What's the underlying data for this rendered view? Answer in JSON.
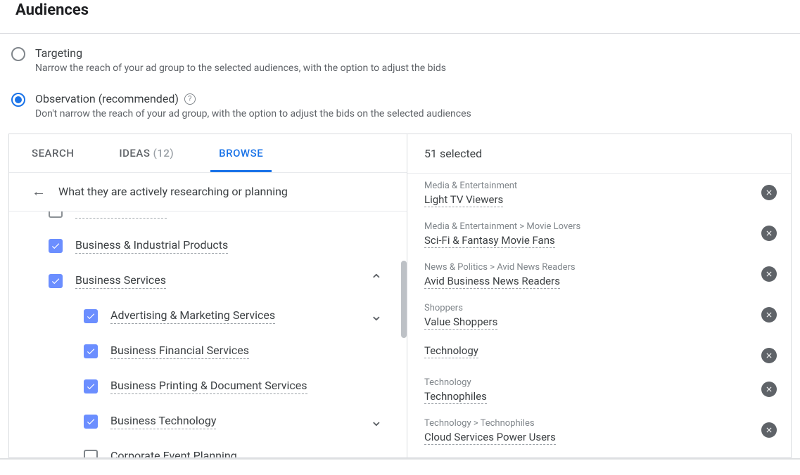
{
  "title": "Audiences",
  "targetingOptions": {
    "targeting": {
      "label": "Targeting",
      "desc": "Narrow the reach of your ad group to the selected audiences, with the option to adjust the bids",
      "selected": false
    },
    "observation": {
      "label": "Observation (recommended)",
      "desc": "Don't narrow the reach of your ad group, with the option to adjust the bids on the selected audiences",
      "selected": true
    }
  },
  "tabs": {
    "search": "SEARCH",
    "ideas_label": "IDEAS",
    "ideas_count": "(12)",
    "browse": "BROWSE"
  },
  "browse": {
    "crumb": "What they are actively researching or planning",
    "items": [
      {
        "label": "",
        "checked": false,
        "cut": true
      },
      {
        "label": "Business & Industrial Products",
        "checked": true
      },
      {
        "label": "Business Services",
        "checked": true,
        "expanded": true,
        "children": [
          {
            "label": "Advertising & Marketing Services",
            "checked": true,
            "hasChildren": true
          },
          {
            "label": "Business Financial Services",
            "checked": true
          },
          {
            "label": "Business Printing & Document Services",
            "checked": true
          },
          {
            "label": "Business Technology",
            "checked": true,
            "hasChildren": true
          },
          {
            "label": "Corporate Event Planning",
            "checked": false
          }
        ]
      }
    ]
  },
  "selectedHeader": "51 selected",
  "selected": [
    {
      "path": "Media & Entertainment",
      "name": "Light TV Viewers"
    },
    {
      "path": "Media & Entertainment > Movie Lovers",
      "name": "Sci-Fi & Fantasy Movie Fans"
    },
    {
      "path": "News & Politics > Avid News Readers",
      "name": "Avid Business News Readers"
    },
    {
      "path": "Shoppers",
      "name": "Value Shoppers"
    },
    {
      "path": "",
      "name": "Technology"
    },
    {
      "path": "Technology",
      "name": "Technophiles"
    },
    {
      "path": "Technology > Technophiles",
      "name": "Cloud Services Power Users"
    }
  ]
}
